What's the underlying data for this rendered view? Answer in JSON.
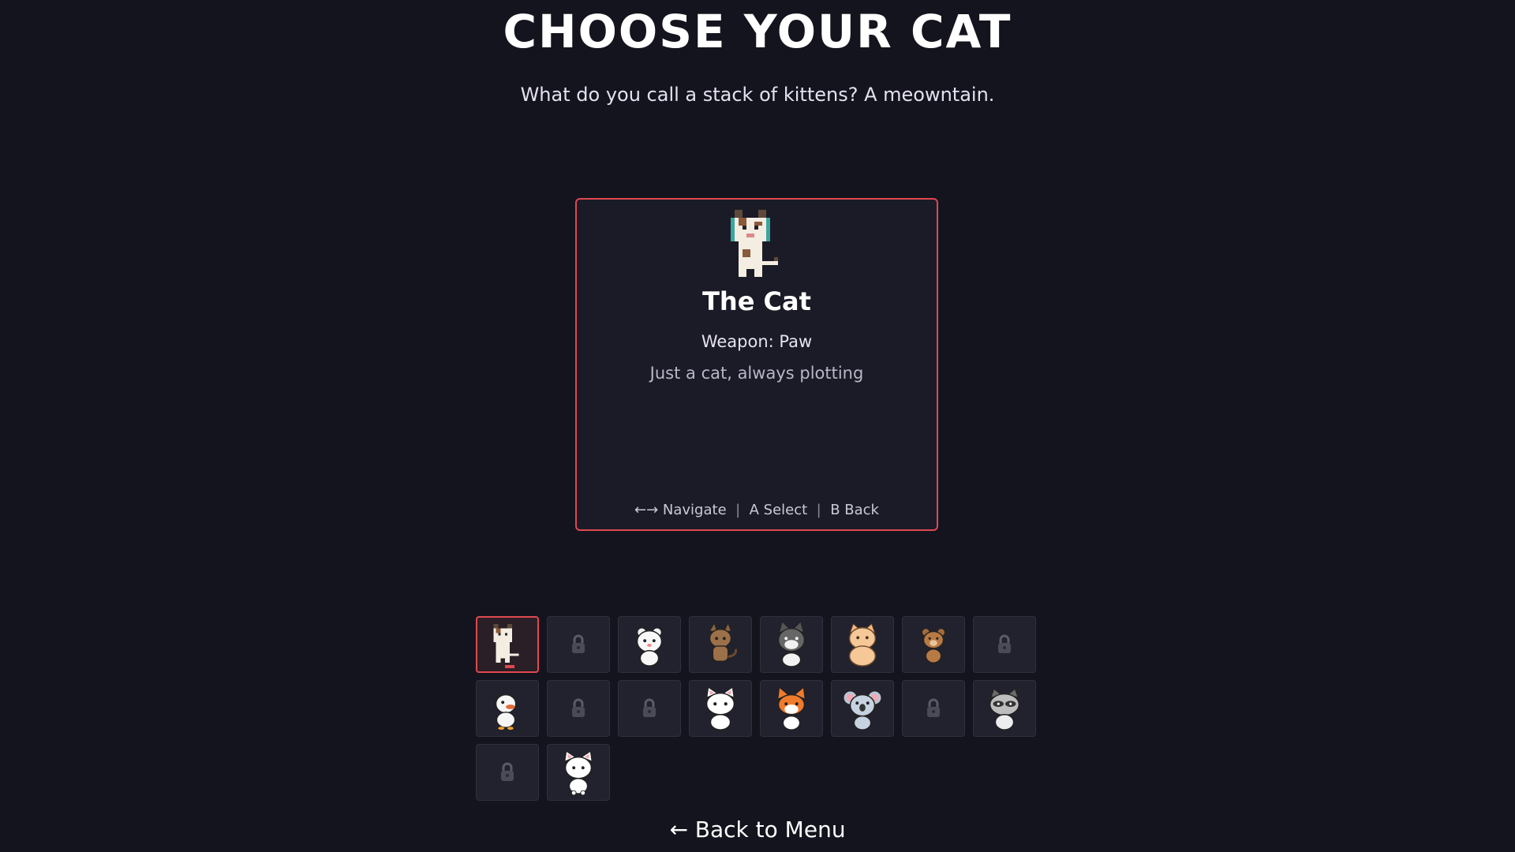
{
  "header": {
    "title": "CHOOSE YOUR CAT",
    "subtitle": "What do you call a stack of kittens? A meowntain."
  },
  "selected_character": {
    "name": "The Cat",
    "weapon": "Weapon: Paw",
    "description": "Just a cat, always plotting",
    "sprite_icon": "pixel-calico-cat-icon"
  },
  "controls_hint": {
    "navigate": "←→ Navigate",
    "select": "A Select",
    "back": "B Back",
    "separator": "|"
  },
  "roster": [
    {
      "state": "unlocked",
      "icon": "pixel-calico-cat-icon",
      "selected": true
    },
    {
      "state": "locked",
      "icon": "lock-icon"
    },
    {
      "state": "unlocked",
      "icon": "white-bear-icon"
    },
    {
      "state": "unlocked",
      "icon": "brown-tabby-cat-icon"
    },
    {
      "state": "unlocked",
      "icon": "gray-cat-icon"
    },
    {
      "state": "unlocked",
      "icon": "orange-chubby-cat-icon"
    },
    {
      "state": "unlocked",
      "icon": "brown-bear-icon"
    },
    {
      "state": "locked",
      "icon": "lock-icon"
    },
    {
      "state": "unlocked",
      "icon": "white-duck-icon"
    },
    {
      "state": "locked",
      "icon": "lock-icon"
    },
    {
      "state": "locked",
      "icon": "lock-icon"
    },
    {
      "state": "unlocked",
      "icon": "white-cat-icon"
    },
    {
      "state": "unlocked",
      "icon": "fox-icon"
    },
    {
      "state": "unlocked",
      "icon": "koala-icon"
    },
    {
      "state": "locked",
      "icon": "lock-icon"
    },
    {
      "state": "unlocked",
      "icon": "raccoon-icon"
    },
    {
      "state": "locked",
      "icon": "lock-icon"
    },
    {
      "state": "unlocked",
      "icon": "white-kitten-icon"
    }
  ],
  "footer": {
    "back_label": "← Back to Menu"
  },
  "colors": {
    "background": "#14141e",
    "accent": "#e0484f",
    "slot": "#22222e"
  }
}
